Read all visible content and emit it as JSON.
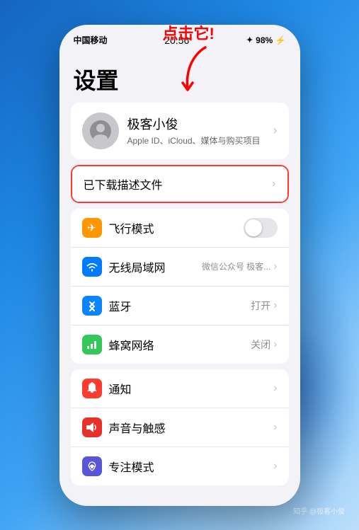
{
  "wallpaper": {
    "colors": [
      "#1565c0",
      "#1e88e5",
      "#42a5f5"
    ]
  },
  "statusBar": {
    "carrier": "中国移动",
    "wifi": "wifi",
    "time": "20:56",
    "bluetooth": "BT",
    "battery_level": "98%"
  },
  "settings": {
    "title": "设置",
    "profile": {
      "name": "极客小俊",
      "subtitle": "Apple ID、iCloud、媒体与购买项目"
    },
    "annotation": {
      "text": "点击它!",
      "target": "already-downloaded"
    },
    "downloaded_profiles_label": "已下载描述文件",
    "groups": [
      {
        "id": "connectivity",
        "rows": [
          {
            "id": "airplane",
            "icon_color": "orange",
            "icon_symbol": "✈",
            "label": "飞行模式",
            "value": "",
            "has_toggle": true,
            "toggle_on": false,
            "has_chevron": false
          },
          {
            "id": "wifi",
            "icon_color": "blue",
            "icon_symbol": "wifi",
            "label": "无线局域网",
            "value": "微信公众号 极客...",
            "has_toggle": false,
            "has_chevron": true
          },
          {
            "id": "bluetooth",
            "icon_color": "blue2",
            "icon_symbol": "bt",
            "label": "蓝牙",
            "value": "打开",
            "has_toggle": false,
            "has_chevron": true
          },
          {
            "id": "cellular",
            "icon_color": "green",
            "icon_symbol": "cellular",
            "label": "蜂窝网络",
            "value": "关闭",
            "has_toggle": false,
            "has_chevron": true
          }
        ]
      },
      {
        "id": "notifications",
        "rows": [
          {
            "id": "notifications",
            "icon_color": "red",
            "icon_symbol": "bell",
            "label": "通知",
            "value": "",
            "has_toggle": false,
            "has_chevron": true
          },
          {
            "id": "sounds",
            "icon_color": "red-dark",
            "icon_symbol": "sound",
            "label": "声音与触感",
            "value": "",
            "has_toggle": false,
            "has_chevron": true
          },
          {
            "id": "focus",
            "icon_color": "purple",
            "icon_symbol": "moon",
            "label": "专注模式",
            "value": "",
            "has_toggle": false,
            "has_chevron": true
          }
        ]
      }
    ]
  },
  "watermark": "知乎 @极客小俊"
}
